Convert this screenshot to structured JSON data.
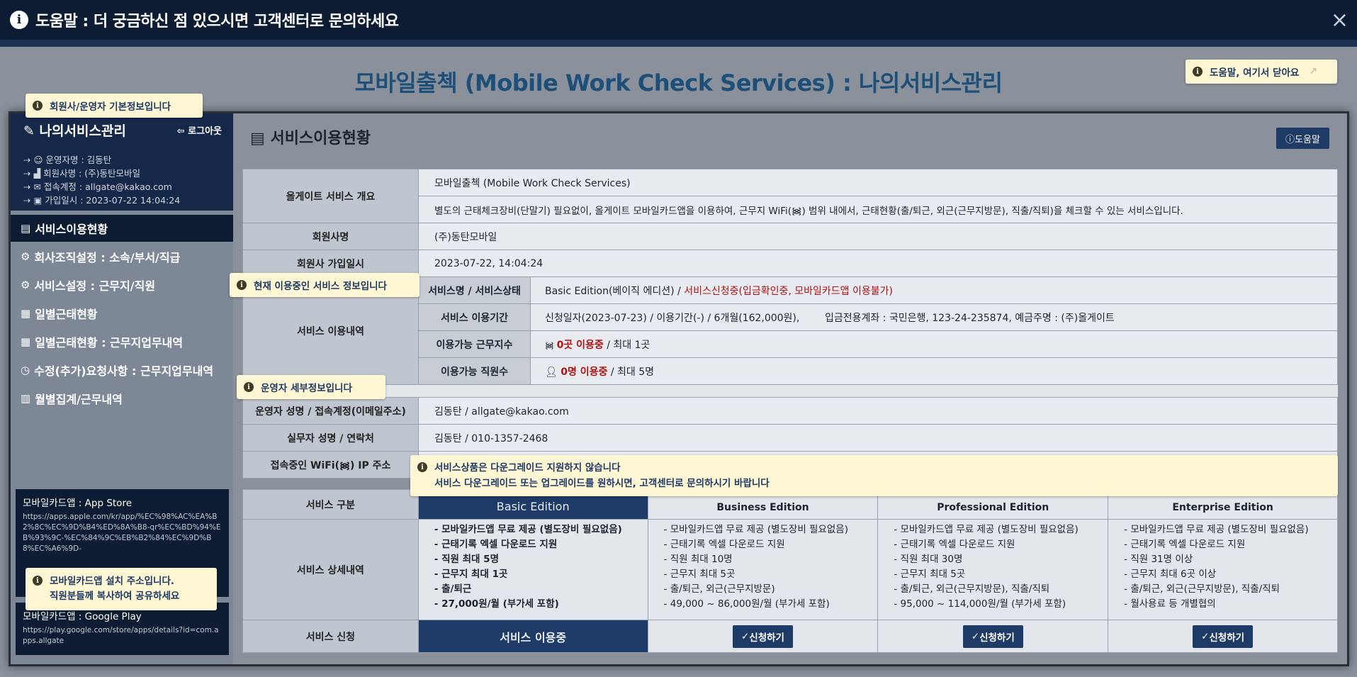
{
  "topbar": {
    "title": "도움말 : 더 궁금하신 점 있으시면 고객센터로 문의하세요",
    "info_icon": "i",
    "close_icon": "×"
  },
  "main_title": "모바일출첵 (Mobile Work Check Services) : 나의서비스관리",
  "tips": {
    "close_help": "도움말, 여기서 닫아요",
    "company_info": "회원사/운영자 기본정보입니다",
    "current_service": "현재 이용중인 서비스 정보입니다",
    "operator_detail": "운영자 세부정보입니다",
    "downgrade_line1": "서비스상품은 다운그레이드 지원하지 않습니다",
    "downgrade_line2": "서비스 다운그레이드 또는 업그레이드를 원하시면, 고객센터로 문의하시기 바랍니다",
    "app_addr_line1": "모바일카드앱 설치 주소입니다.",
    "app_addr_line2": "직원분들께 복사하여 공유하세요"
  },
  "sidebar": {
    "title": "나의서비스관리",
    "logout": "로그아웃",
    "info": [
      {
        "icon": "user-icon",
        "text": "운영자명 : 김동탄"
      },
      {
        "icon": "building-icon",
        "text": "회원사명 : (주)동탄모바일"
      },
      {
        "icon": "mail-icon",
        "text": "접속계정 : allgate@kakao.com"
      },
      {
        "icon": "calendar-icon",
        "text": "가입일시 : 2023-07-22 14:04:24"
      }
    ],
    "menu": [
      {
        "label": "서비스이용현황",
        "icon": "clipboard-icon"
      },
      {
        "label": "회사조직설정 : 소속/부서/직급",
        "icon": "gear-icon"
      },
      {
        "label": "서비스설정 : 근무지/직원",
        "icon": "gear-icon"
      },
      {
        "label": "일별근태현황",
        "icon": "calendar-icon"
      },
      {
        "label": "일별근태현황 : 근무지업무내역",
        "icon": "calendar-icon"
      },
      {
        "label": "수정(추가)요청사항 : 근무지업무내역",
        "icon": "clock-icon"
      },
      {
        "label": "월별집계/근무내역",
        "icon": "bar-chart-icon"
      }
    ],
    "apps": [
      {
        "title": "모바일카드앱 : App Store",
        "url": "https://apps.apple.com/kr/app/%EC%98%AC%EA%B2%8C%EC%9D%B4%ED%8A%B8-qr%EC%BD%94%EB%93%9C-%EC%84%9C%EB%B2%84%EC%9D%B8%EC%A6%9D-"
      },
      {
        "title": "모바일카드앱 : Google Play",
        "url": "https://play.google.com/store/apps/details?id=com.apps.allgate"
      }
    ]
  },
  "content": {
    "title": "서비스이용현황",
    "help_button": "도움말",
    "overview_label": "올게이트 서비스 개요",
    "overview_name": "모바일출첵 (Mobile Work Check Services)",
    "overview_desc": "별도의 근태체크장비(단말기) 필요없이, 올게이트 모바일카드앱을 이용하여, 근무지 WiFi(᯼) 범위 내에서, 근태현황(출/퇴근, 외근(근무지방문), 직출/직퇴)을 체크할 수 있는 서비스입니다.",
    "company_label": "회원사명",
    "company_value": "(주)동탄모바일",
    "joined_label": "회원사 가입일시",
    "joined_value": "2023-07-22, 14:04:24",
    "usage_label": "서비스 이용내역",
    "svc_name_label": "서비스명 / 서비스상태",
    "svc_name_value": "Basic Edition(베이직 에디션) / ",
    "svc_status": "서비스신청중(입금확인중, 모바일카드앱 이용불가)",
    "period_label": "서비스 이용기간",
    "period_value": "신청일자(2023-07-23) / 이용기간(-) / 6개월(162,000원),        입금전용계좌 : 국민은행, 123-24-235874, 예금주명 : (주)올게이트",
    "sites_label": "이용가능 근무지수",
    "sites_used": "0곳 이용중",
    "sites_max": " / 최대 1곳",
    "staff_label": "이용가능 직원수",
    "staff_used": "0명 이용중",
    "staff_max": " / 최대 5명",
    "operator_label": "운영자 성명 / 접속계정(이메일주소)",
    "operator_value": "김동탄 / allgate@kakao.com",
    "worker_label": "실무자 성명 / 연락처",
    "worker_value": "김동탄 / 010-1357-2468",
    "ip_label": "접속중인 WiFi(᯼) IP 주소",
    "ip_value": ""
  },
  "services": {
    "type_label": "서비스 구분",
    "detail_label": "서비스 상세내역",
    "apply_label": "서비스 신청",
    "in_use": "서비스 이용중",
    "apply_button": "신청하기",
    "editions": [
      {
        "name": "Basic Edition",
        "details": [
          "- 모바일카드앱 무료 제공 (별도장비 필요없음)",
          "- 근태기록 엑셀 다운로드 지원",
          "- 직원 최대 5명",
          "- 근무지 최대 1곳",
          "- 출/퇴근",
          "- 27,000원/월 (부가세 포함)"
        ]
      },
      {
        "name": "Business Edition",
        "details": [
          "- 모바일카드앱 무료 제공 (별도장비 필요없음)",
          "- 근태기록 엑셀 다운로드 지원",
          "- 직원 최대 10명",
          "- 근무지 최대 5곳",
          "- 출/퇴근, 외근(근무지방문)",
          "- 49,000 ~ 86,000원/월 (부가세 포함)"
        ]
      },
      {
        "name": "Professional Edition",
        "details": [
          "- 모바일카드앱 무료 제공 (별도장비 필요없음)",
          "- 근태기록 엑셀 다운로드 지원",
          "- 직원 최대 30명",
          "- 근무지 최대 5곳",
          "- 출/퇴근, 외근(근무지방문), 직출/직퇴",
          "- 95,000 ~ 114,000원/월 (부가세 포함)"
        ]
      },
      {
        "name": "Enterprise Edition",
        "details": [
          "- 모바일카드앱 무료 제공 (별도장비 필요없음)",
          "- 근태기록 엑셀 다운로드 지원",
          "- 직원 31명 이상",
          "- 근무지 최대 6곳 이상",
          "- 출/퇴근, 외근(근무지방문), 직출/직퇴",
          "- 월사용료 등 개별협의"
        ]
      }
    ]
  }
}
